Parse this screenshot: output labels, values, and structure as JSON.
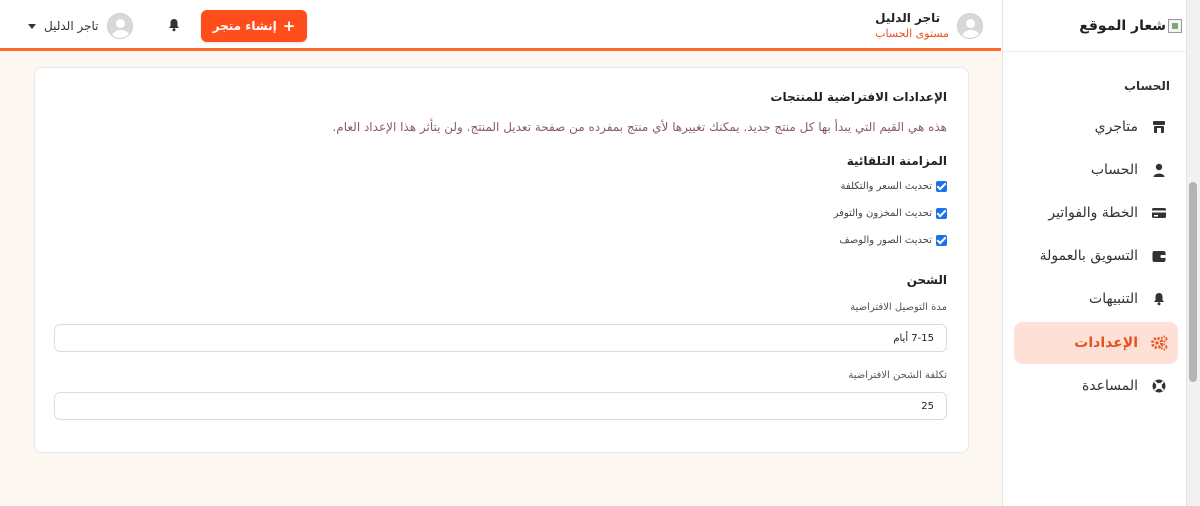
{
  "sidebar": {
    "logo_text": "شعار الموقع",
    "section_title": "الحساب",
    "items": [
      {
        "label": "متاجري",
        "icon": "store-icon",
        "active": false
      },
      {
        "label": "الحساب",
        "icon": "user-icon",
        "active": false
      },
      {
        "label": "الخطة والفواتير",
        "icon": "credit-card-icon",
        "active": false
      },
      {
        "label": "التسويق بالعمولة",
        "icon": "wallet-icon",
        "active": false
      },
      {
        "label": "التنبيهات",
        "icon": "bell-icon",
        "active": false
      },
      {
        "label": "الإعدادات",
        "icon": "cogs-icon",
        "active": true
      },
      {
        "label": "المساعدة",
        "icon": "lifebuoy-icon",
        "active": false
      }
    ]
  },
  "header": {
    "user_name": "تاجر الدليل",
    "user_level": "مستوى الحساب",
    "create_button": "إنشاء متجر",
    "menu_user_name": "تاجر الدليل"
  },
  "settings": {
    "title": "الإعدادات الافتراضية للمنتجات",
    "description": "هذه هي القيم التي يبدأ بها كل منتج جديد. يمكنك تغييرها لأي منتج بمفرده من صفحة تعديل المنتج. ولن يتأثر هذا الإعداد العام.",
    "sync_title": "المزامنة التلقائية",
    "checkboxes": [
      {
        "label": "تحديث السعر والتكلفة",
        "checked": true
      },
      {
        "label": "تحديث المخزون والتوفر",
        "checked": true
      },
      {
        "label": "تحديث الصور والوصف",
        "checked": true
      }
    ],
    "shipping_title": "الشحن",
    "delivery_label": "مدة التوصيل الافتراضية",
    "delivery_value": "7-15 أيام",
    "cost_label": "تكلفة الشحن الافتراضية",
    "cost_value": "25"
  },
  "colors": {
    "accent": "#ff4d1c",
    "active_bg": "#fde0d6",
    "checkbox": "#1a73e8"
  }
}
